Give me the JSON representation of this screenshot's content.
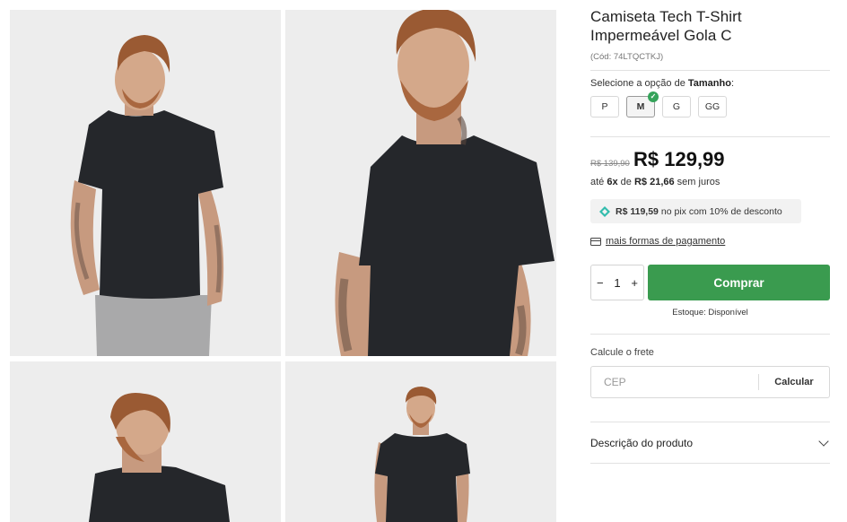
{
  "product": {
    "title_line1": "Camiseta Tech T-Shirt",
    "title_line2": "Impermeável Gola C",
    "sku": "(Cód: 74LTQCTKJ)"
  },
  "size_selector": {
    "prompt_prefix": "Selecione a opção de ",
    "prompt_bold": "Tamanho",
    "prompt_suffix": ":",
    "options": [
      "P",
      "M",
      "G",
      "GG"
    ],
    "selected": "M"
  },
  "pricing": {
    "old_price": "R$ 139,90",
    "price": "R$ 129,99",
    "installments_prefix": "até ",
    "installments_count": "6x",
    "installments_mid": " de ",
    "installments_value": "R$ 21,66",
    "installments_suffix": " sem juros",
    "pix_value": "R$ 119,59",
    "pix_text": "no pix com 10% de desconto",
    "payment_link": "mais formas de pagamento"
  },
  "purchase": {
    "qty_minus": "−",
    "qty_value": "1",
    "qty_plus": "+",
    "buy_label": "Comprar",
    "stock_text": "Estoque: Disponível"
  },
  "shipping": {
    "label": "Calcule o frete",
    "cep_placeholder": "CEP",
    "calc_label": "Calcular"
  },
  "description": {
    "label": "Descrição do produto"
  },
  "colors": {
    "buy_green": "#3a9b4f",
    "check_green": "#35a35a",
    "shirt": "#25272b",
    "pix_icon": "#32bcad"
  }
}
